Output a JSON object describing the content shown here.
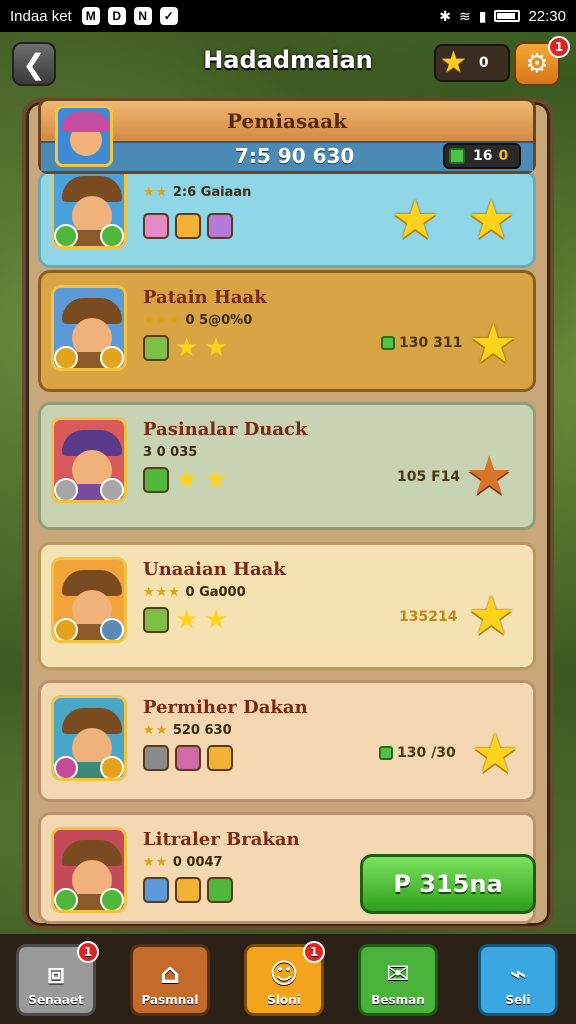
{
  "status_bar": {
    "carrier": "Indaa ket",
    "time": "22:30"
  },
  "topbar": {
    "title": "Hadadmaian",
    "star_count": "0",
    "settings_badge": "1"
  },
  "header": {
    "banner": "Pemiasaak",
    "score": "7:5 90 630",
    "currency_value": "16",
    "currency_value2": "0"
  },
  "cards": [
    {
      "name": "",
      "sub_stars": "★★",
      "sub_text": "2:6 Gaiaan",
      "amount": "",
      "bg": "#8fd6e6"
    },
    {
      "name": "Patain Haak",
      "sub_stars": "★★★",
      "sub_text": "0 5@0%0",
      "amount": "130 311",
      "bg": "#d9a443"
    },
    {
      "name": "Pasinalar Duack",
      "sub_stars": "",
      "sub_text": "3 0 035",
      "amount": "105 F14",
      "bg": "#c7d3b2"
    },
    {
      "name": "Unaaian Haak",
      "sub_stars": "★★★",
      "sub_text": "0 Ga000",
      "amount": "135214",
      "bg": "#f5e2b3"
    },
    {
      "name": "Permiher Dakan",
      "sub_stars": "★★",
      "sub_text": "520 630",
      "amount": "130 /30",
      "bg": "#f3d8b1"
    },
    {
      "name": "Litraler Brakan",
      "sub_stars": "★★",
      "sub_text": "0 0047",
      "amount": "",
      "bg": "#f3d8b1"
    }
  ],
  "action": {
    "play_label": "P 315na"
  },
  "bottom_nav": [
    {
      "label": "Senaaet",
      "badge": "1",
      "icon_name": "box-icon",
      "color": "#9a9a9a"
    },
    {
      "label": "Pasmnal",
      "badge": "",
      "icon_name": "home-icon",
      "color": "#c46a2a"
    },
    {
      "label": "Sloni",
      "badge": "1",
      "icon_name": "ghost-icon",
      "color": "#f4a41c"
    },
    {
      "label": "Besman",
      "badge": "",
      "icon_name": "chat-icon",
      "color": "#48b23a"
    },
    {
      "label": "Seli",
      "badge": "",
      "icon_name": "ticket-icon",
      "color": "#3aa7e0"
    }
  ]
}
